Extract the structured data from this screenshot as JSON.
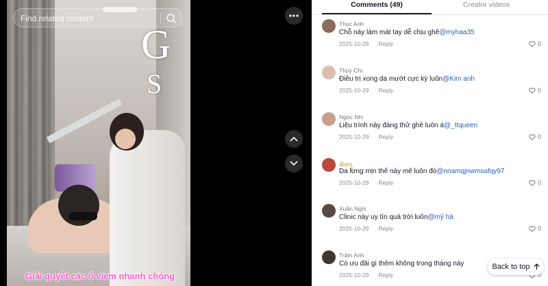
{
  "search": {
    "placeholder": "Find related content"
  },
  "video": {
    "logo_letters": [
      "G",
      "S"
    ],
    "caption": "Giải quyết các ổ viêm nhanh chóng"
  },
  "icons": {
    "search": "search-icon",
    "more": "more-horizontal-icon",
    "up": "chevron-up-icon",
    "down": "chevron-down-icon",
    "heart": "heart-icon",
    "back_to_top": "chevron-up-icon"
  },
  "tabs": {
    "comments": "Comments (49)",
    "creator": "Creator videos"
  },
  "comments": [
    {
      "name": "Thục Anh",
      "text": "Chỗ này làm mát tay dễ chịu ghê",
      "mention": "@myhaa35",
      "date": "2025-10-29",
      "reply": "Reply",
      "likes": "0",
      "avatar_color": "#8a6d5a"
    },
    {
      "name": "Thuỳ Chi",
      "text": "Điều trị xong da mướt cực kỳ luôn",
      "mention": "@Kim anh",
      "date": "2025-10-29",
      "reply": "Reply",
      "likes": "0",
      "avatar_color": "#d9bfae"
    },
    {
      "name": "Ngọc Nhi",
      "text": "Liệu trình này đáng thử ghê luôn á",
      "mention": "@_ttqueen",
      "date": "2025-10-29",
      "reply": "Reply",
      "likes": "0",
      "avatar_color": "#c9a08c"
    },
    {
      "name": "ꦤꦶꦧꦸ",
      "text": "Da lưng mịn thế này mê luôn đó",
      "mention": "@nnamqjnwmsafqy97",
      "date": "2025-10-29",
      "reply": "Reply",
      "likes": "0",
      "avatar_color": "#b9463f"
    },
    {
      "name": "Xuân Nghi",
      "text": "Clinic này uy tín quá trời luôn",
      "mention": "@mỹ hà",
      "date": "2025-10-29",
      "reply": "Reply",
      "likes": "0",
      "avatar_color": "#5a4a44"
    },
    {
      "name": "Trâm Anh",
      "text": "Có ưu đãi gì thêm không trong tháng này",
      "mention": "",
      "date": "2025-10-29",
      "reply": "Reply",
      "likes": "0",
      "avatar_color": "#3d3733"
    }
  ],
  "back_to_top": "Back to top"
}
